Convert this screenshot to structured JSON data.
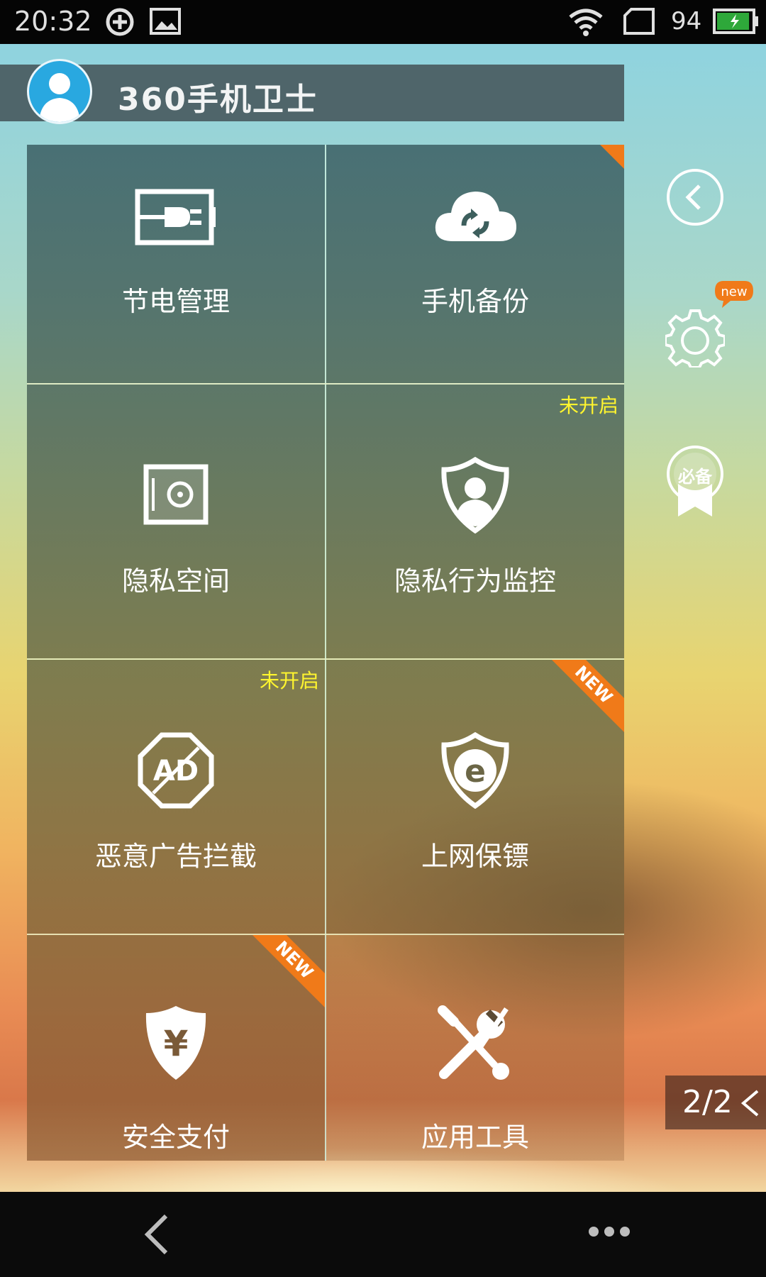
{
  "status_bar": {
    "time": "20:32",
    "battery_percent": "94",
    "battery_level": 0.94,
    "icons": [
      "sync-icon",
      "image-icon",
      "wifi-icon",
      "sim-icon",
      "battery-icon"
    ]
  },
  "header": {
    "title": "360手机卫士",
    "avatar_icon": "user-avatar-icon"
  },
  "tiles": [
    {
      "label": "节电管理",
      "icon": "battery-plug-icon",
      "status": "",
      "badge": ""
    },
    {
      "label": "手机备份",
      "icon": "cloud-sync-icon",
      "status": "",
      "badge": ""
    },
    {
      "label": "隐私空间",
      "icon": "safe-icon",
      "status": "",
      "badge": ""
    },
    {
      "label": "隐私行为监控",
      "icon": "shield-person-icon",
      "status": "未开启",
      "badge": ""
    },
    {
      "label": "恶意广告拦截",
      "icon": "ad-block-icon",
      "status": "未开启",
      "badge": ""
    },
    {
      "label": "上网保镖",
      "icon": "shield-e-icon",
      "status": "",
      "badge": "NEW"
    },
    {
      "label": "安全支付",
      "icon": "shield-yen-icon",
      "status": "",
      "badge": "NEW"
    },
    {
      "label": "应用工具",
      "icon": "wrench-screwdriver-icon",
      "status": "",
      "badge": ""
    }
  ],
  "side": {
    "back_icon": "back-circle-icon",
    "settings_icon": "gear-icon",
    "settings_badge": "new",
    "essentials_icon": "badge-bookmark-icon",
    "essentials_glyph": "必备"
  },
  "pager": {
    "text": "2/2"
  },
  "nav": {
    "back_icon": "back-icon",
    "more_icon": "more-icon"
  },
  "colors": {
    "status_off": "#fff52e",
    "ribbon": "#f07a19",
    "avatar": "#29a8e0"
  }
}
